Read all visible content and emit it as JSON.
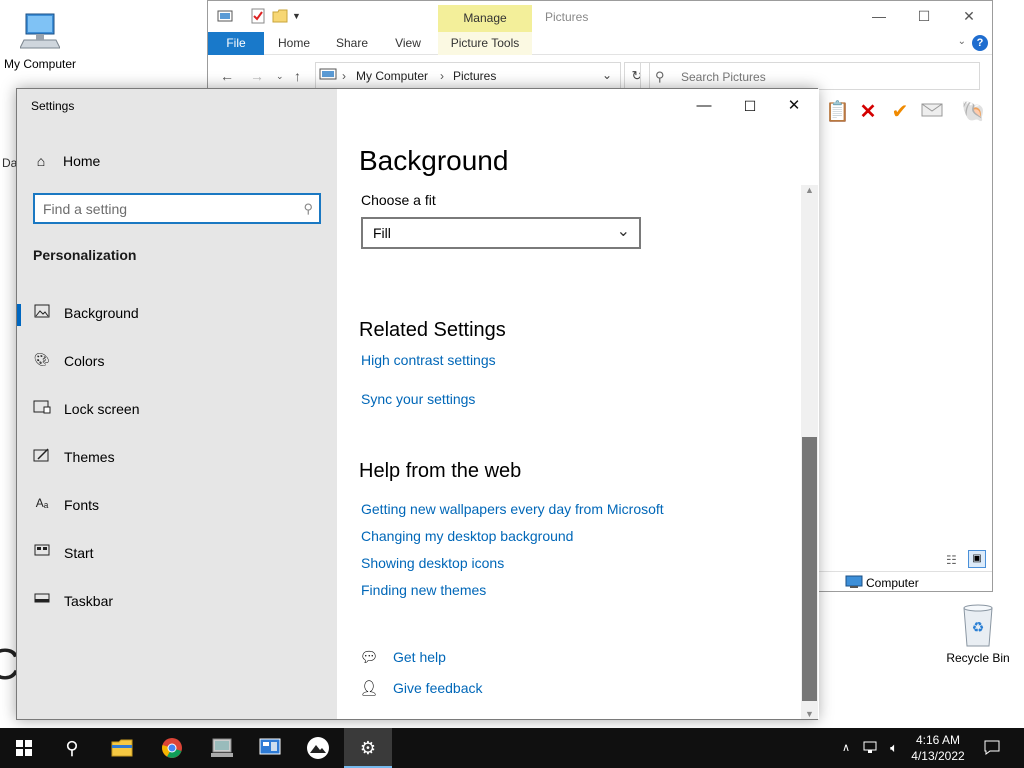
{
  "desktop": {
    "icons": [
      {
        "label": "My Computer",
        "icon": "computer-icon"
      },
      {
        "label": "Recycle Bin",
        "icon": "recycle-bin-icon"
      }
    ]
  },
  "explorer": {
    "title": "Pictures",
    "manage_tab": "Manage",
    "ribbon_tabs": [
      "File",
      "Home",
      "Share",
      "View",
      "Picture Tools"
    ],
    "breadcrumb": [
      "My Computer",
      "Pictures"
    ],
    "search_placeholder": "Search Pictures",
    "status_location": "Computer"
  },
  "settings": {
    "window_title": "Settings",
    "home_label": "Home",
    "search_placeholder": "Find a setting",
    "section_title": "Personalization",
    "nav": [
      {
        "label": "Background",
        "icon": "picture-icon",
        "active": true
      },
      {
        "label": "Colors",
        "icon": "palette-icon",
        "active": false
      },
      {
        "label": "Lock screen",
        "icon": "lock-screen-icon",
        "active": false
      },
      {
        "label": "Themes",
        "icon": "themes-icon",
        "active": false
      },
      {
        "label": "Fonts",
        "icon": "fonts-icon",
        "active": false
      },
      {
        "label": "Start",
        "icon": "start-icon",
        "active": false
      },
      {
        "label": "Taskbar",
        "icon": "taskbar-icon",
        "active": false
      }
    ],
    "page_title": "Background",
    "fit_label": "Choose a fit",
    "fit_value": "Fill",
    "related_title": "Related Settings",
    "related_links": [
      "High contrast settings",
      "Sync your settings"
    ],
    "help_title": "Help from the web",
    "help_links": [
      "Getting new wallpapers every day from Microsoft",
      "Changing my desktop background",
      "Showing desktop icons",
      "Finding new themes"
    ],
    "get_help": "Get help",
    "give_feedback": "Give feedback"
  },
  "taskbar": {
    "time": "4:16 AM",
    "date": "4/13/2022",
    "accent": "#76b9ed"
  }
}
